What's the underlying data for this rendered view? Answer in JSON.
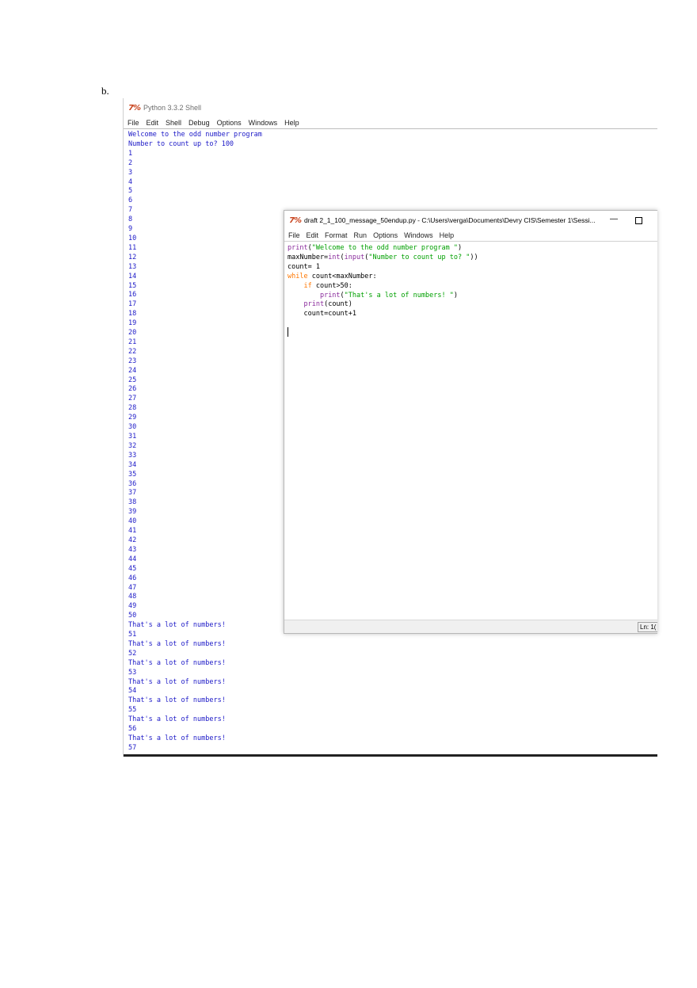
{
  "doc_label": "b.",
  "shell": {
    "logo": "7%",
    "title": "Python 3.3.2 Shell",
    "menu": [
      "File",
      "Edit",
      "Shell",
      "Debug",
      "Options",
      "Windows",
      "Help"
    ],
    "output_lines": [
      "Welcome to the odd number program",
      "Number to count up to? 100",
      "1",
      "2",
      "3",
      "4",
      "5",
      "6",
      "7",
      "8",
      "9",
      "10",
      "11",
      "12",
      "13",
      "14",
      "15",
      "16",
      "17",
      "18",
      "19",
      "20",
      "21",
      "22",
      "23",
      "24",
      "25",
      "26",
      "27",
      "28",
      "29",
      "30",
      "31",
      "32",
      "33",
      "34",
      "35",
      "36",
      "37",
      "38",
      "39",
      "40",
      "41",
      "42",
      "43",
      "44",
      "45",
      "46",
      "47",
      "48",
      "49",
      "50",
      "That's a lot of numbers!",
      "51",
      "That's a lot of numbers!",
      "52",
      "That's a lot of numbers!",
      "53",
      "That's a lot of numbers!",
      "54",
      "That's a lot of numbers!",
      "55",
      "That's a lot of numbers!",
      "56",
      "That's a lot of numbers!",
      "57"
    ]
  },
  "editor": {
    "logo": "7%",
    "title": "draft 2_1_100_message_50endup.py - C:\\Users\\verga\\Documents\\Devry CIS\\Semester 1\\Sessi...",
    "minimize": "—",
    "menu": [
      "File",
      "Edit",
      "Format",
      "Run",
      "Options",
      "Windows",
      "Help"
    ],
    "code": {
      "l1_fn": "print",
      "l1_open": "(",
      "l1_str": "\"Welcome to the odd number program \"",
      "l1_close": ")",
      "l2_a": "maxNumber=",
      "l2_int": "int",
      "l2_b": "(",
      "l2_input": "input",
      "l2_c": "(",
      "l2_str": "\"Number to count up to? \"",
      "l2_d": "))",
      "l3": "count= 1",
      "l4_kw": "while",
      "l4_rest": " count<maxNumber:",
      "l5_kw": "if",
      "l5_rest": " count>50:",
      "l6_fn": "print",
      "l6_open": "(",
      "l6_str": "\"That's a lot of numbers! \"",
      "l6_close": ")",
      "l7_fn": "print",
      "l7_rest": "(count)",
      "l8": "count=count+1"
    },
    "status": "Ln: 1("
  },
  "colors": {
    "shell_output": "#1c19c7",
    "keyword": "#ff7700",
    "builtin": "#8a2b9c",
    "string": "#00a000",
    "logo": "#c8431d"
  }
}
